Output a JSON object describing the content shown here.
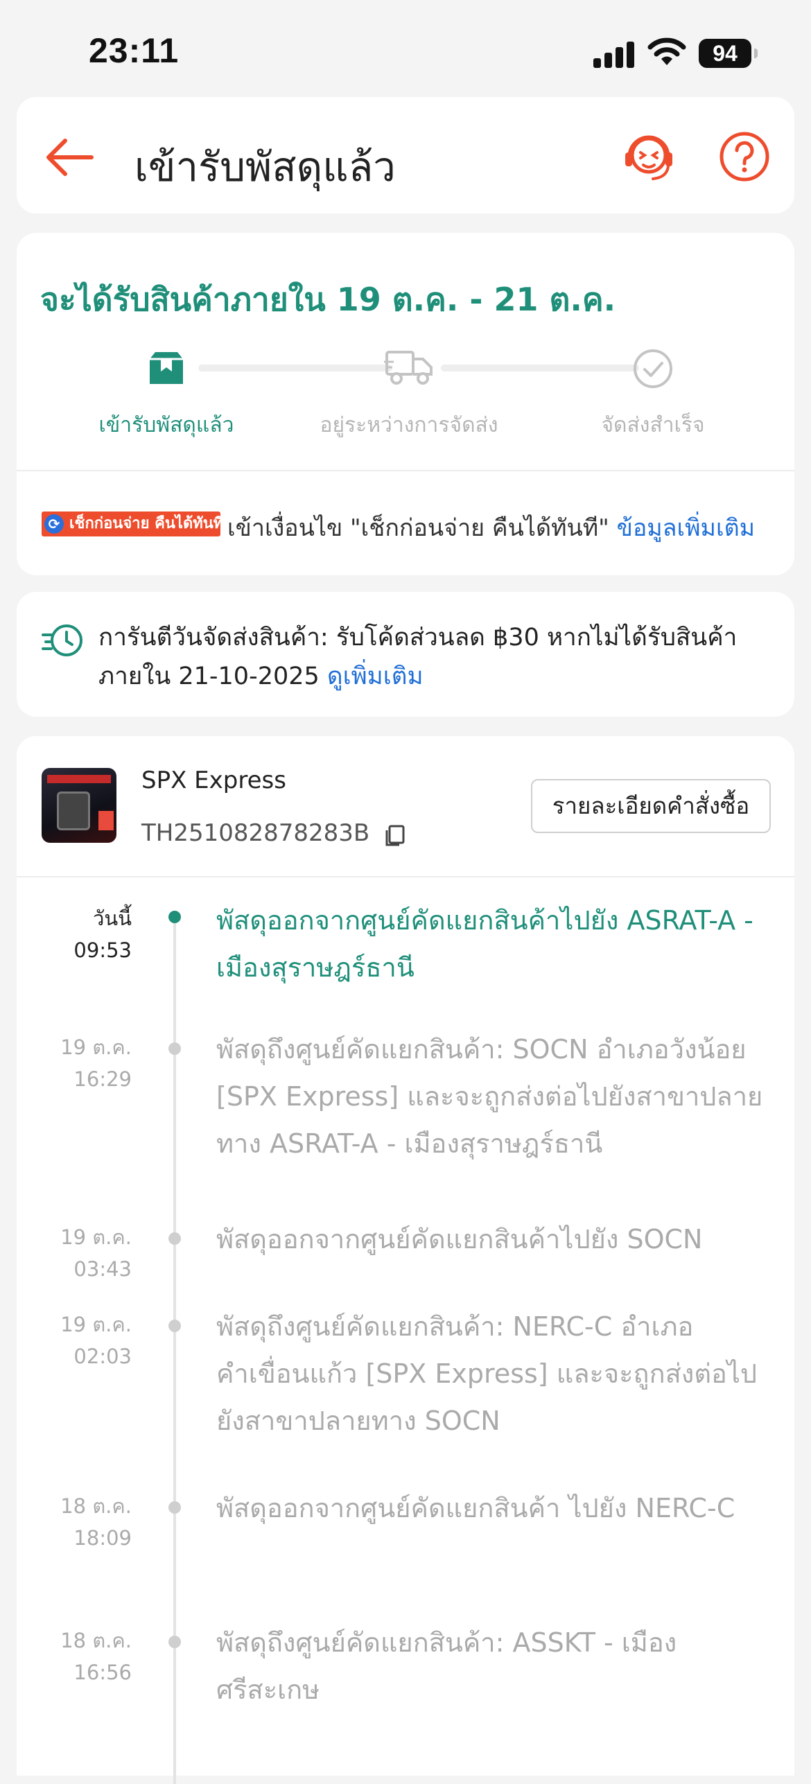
{
  "status_bar": {
    "time": "23:11",
    "battery": "94"
  },
  "header": {
    "title": "เข้ารับพัสดุแล้ว"
  },
  "delivery": {
    "eta": "จะได้รับสินค้าภายใน 19 ต.ค. - 21 ต.ค.",
    "steps": [
      {
        "label": "เข้ารับพัสดุแล้ว",
        "icon": "box-icon",
        "state": "active"
      },
      {
        "label": "อยู่ระหว่างการจัดส่ง",
        "icon": "truck-icon",
        "state": "inactive"
      },
      {
        "label": "จัดส่งสำเร็จ",
        "icon": "check-circle-icon",
        "state": "inactive"
      }
    ],
    "guarantee_badge": "เช็กก่อนจ่าย คืนได้ทันที",
    "guarantee_text": "เข้าเงื่อนไข \"เช็กก่อนจ่าย คืนได้ทันที\"",
    "guarantee_link": "ข้อมูลเพิ่มเติม"
  },
  "promise": {
    "text": "การันตีวันจัดส่งสินค้า: รับโค้ดส่วนลด ฿30 หากไม่ได้รับสินค้าภายใน 21-10-2025",
    "link": "ดูเพิ่มเติม"
  },
  "shipment": {
    "carrier": "SPX Express",
    "tracking_number": "TH251082878283B",
    "order_details_button": "รายละเอียดคำสั่งซื้อ"
  },
  "timeline": [
    {
      "date": "วันนี้",
      "time": "09:53",
      "text": "พัสดุออกจากศูนย์คัดแยกสินค้าไปยัง ASRAT-A - เมืองสุราษฎร์ธานี",
      "state": "current"
    },
    {
      "date": "19 ต.ค.",
      "time": "16:29",
      "text": "พัสดุถึงศูนย์คัดแยกสินค้า: SOCN อำเภอวังน้อย [SPX Express] และจะถูกส่งต่อไปยังสาขาปลายทาง ASRAT-A - เมืองสุราษฎร์ธานี",
      "state": "past"
    },
    {
      "date": "19 ต.ค.",
      "time": "03:43",
      "text": "พัสดุออกจากศูนย์คัดแยกสินค้าไปยัง SOCN",
      "state": "past"
    },
    {
      "date": "19 ต.ค.",
      "time": "02:03",
      "text": "พัสดุถึงศูนย์คัดแยกสินค้า: NERC-C อำเภอคำเขื่อนแก้ว [SPX Express] และจะถูกส่งต่อไปยังสาขาปลายทาง SOCN",
      "state": "past"
    },
    {
      "date": "18 ต.ค.",
      "time": "18:09",
      "text": "พัสดุออกจากศูนย์คัดแยกสินค้า ไปยัง NERC-C",
      "state": "past"
    },
    {
      "date": "18 ต.ค.",
      "time": "16:56",
      "text": "พัสดุถึงศูนย์คัดแยกสินค้า: ASSKT - เมืองศรีสะเกษ",
      "state": "past"
    }
  ],
  "colors": {
    "accent": "#ee4d2d",
    "teal": "#1f8f7a",
    "link": "#1f6fd6"
  }
}
